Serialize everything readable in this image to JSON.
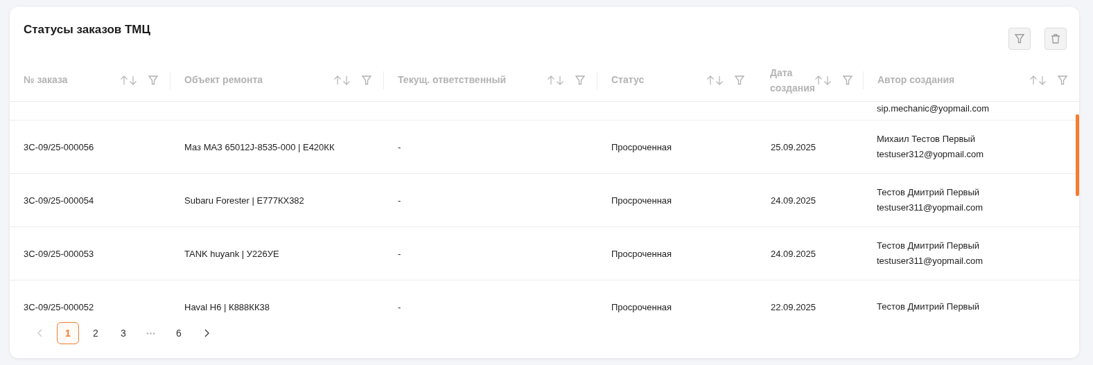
{
  "title": "Статусы заказов ТМЦ",
  "columns": [
    "№ заказа",
    "Объект ремонта",
    "Текущ. ответственный",
    "Статус",
    "Дата создания",
    "Автор создания"
  ],
  "rows": [
    {
      "author_email": "sip.mechanic@yopmail.com"
    },
    {
      "order": "3С-09/25-000056",
      "object": "Маз МАЗ 65012J-8535-000 | Е420КК",
      "responsible": "-",
      "status": "Просроченная",
      "date": "25.09.2025",
      "author_name": "Михаил Тестов Первый",
      "author_email": "testuser312@yopmail.com"
    },
    {
      "order": "3С-09/25-000054",
      "object": "Subaru Forester | Е777КХ382",
      "responsible": "-",
      "status": "Просроченная",
      "date": "24.09.2025",
      "author_name": "Тестов Дмитрий Первый",
      "author_email": "testuser311@yopmail.com"
    },
    {
      "order": "3С-09/25-000053",
      "object": "TANK huyank | У226УЕ",
      "responsible": "-",
      "status": "Просроченная",
      "date": "24.09.2025",
      "author_name": "Тестов Дмитрий Первый",
      "author_email": "testuser311@yopmail.com"
    },
    {
      "order": "3С-09/25-000052",
      "object": "Haval H6 | К888КК38",
      "responsible": "-",
      "status": "Просроченная",
      "date": "22.09.2025",
      "author_name": "Тестов Дмитрий Первый"
    }
  ],
  "pagination": {
    "prev_disabled": true,
    "next_disabled": false,
    "items": [
      {
        "kind": "page",
        "label": "1",
        "selected": true
      },
      {
        "kind": "page",
        "label": "2",
        "selected": false
      },
      {
        "kind": "page",
        "label": "3",
        "selected": false
      },
      {
        "kind": "ellipsis",
        "label": "•••"
      },
      {
        "kind": "page",
        "label": "6",
        "selected": false
      }
    ]
  }
}
